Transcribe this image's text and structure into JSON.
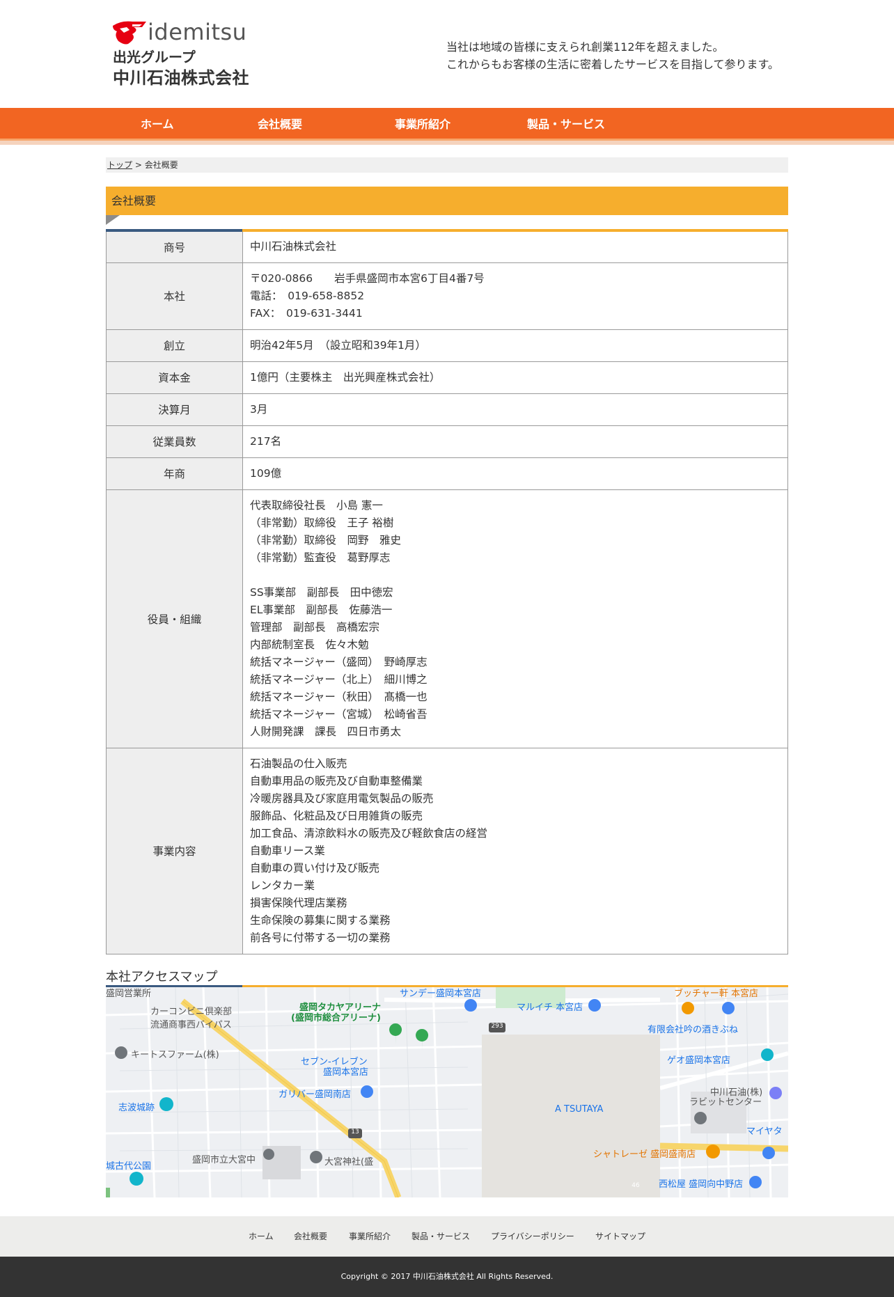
{
  "header": {
    "logo_word": "idemitsu",
    "logo_group": "出光グループ",
    "logo_company": "中川石油株式会社",
    "tagline_line1": "当社は地域の皆様に支えられ創業112年を超えました。",
    "tagline_line2": "これからもお客様の生活に密着したサービスを目指して参ります。"
  },
  "nav": {
    "items": [
      "ホーム",
      "会社概要",
      "事業所紹介",
      "製品・サービス"
    ]
  },
  "breadcrumb": {
    "top": "トップ",
    "separator": " > ",
    "current": "会社概要"
  },
  "section": {
    "title": "会社概要"
  },
  "company": {
    "rows": [
      {
        "label": "商号",
        "lines": [
          "中川石油株式会社"
        ]
      },
      {
        "label": "本社",
        "lines": [
          "〒020-0866　　岩手県盛岡市本宮6丁目4番7号",
          "電話：　019-658-8852",
          "FAX：　019-631-3441"
        ]
      },
      {
        "label": "創立",
        "lines": [
          "明治42年5月　（設立昭和39年1月）"
        ]
      },
      {
        "label": "資本金",
        "lines": [
          "1億円（主要株主　出光興産株式会社）"
        ]
      },
      {
        "label": "決算月",
        "lines": [
          "3月"
        ]
      },
      {
        "label": "従業員数",
        "lines": [
          "217名"
        ]
      },
      {
        "label": "年商",
        "lines": [
          "109億"
        ]
      },
      {
        "label": "役員・組織",
        "lines": [
          "代表取締役社長　小島 憲一",
          "（非常勤）取締役　王子 裕樹",
          "（非常勤）取締役　岡野　雅史",
          "（非常勤）監査役　葛野厚志",
          "",
          "SS事業部　副部長　田中徳宏",
          "EL事業部　副部長　佐藤浩一",
          "管理部　副部長　高橋宏宗",
          "内部統制室長　佐々木勉",
          "統括マネージャー（盛岡）　野崎厚志",
          "統括マネージャー（北上）　細川博之",
          "統括マネージャー（秋田）　髙橋一也",
          "統括マネージャー（宮城）　松崎省吾",
          "人財開発課　課長　四日市勇太"
        ]
      },
      {
        "label": "事業内容",
        "lines": [
          "石油製品の仕入販売",
          "自動車用品の販売及び自動車整備業",
          "冷暖房器具及び家庭用電気製品の販売",
          "服飾品、化粧品及び日用雑貨の販売",
          "加工食品、清涼飲料水の販売及び軽飲食店の経営",
          "自動車リース業",
          "自動車の買い付け及び販売",
          "レンタカー業",
          "損害保険代理店業務",
          "生命保険の募集に関する業務",
          "前各号に付帯する一切の業務"
        ]
      }
    ]
  },
  "map": {
    "title": "本社アクセスマップ",
    "labels": [
      {
        "text": "盛岡営業所",
        "color": "#555"
      },
      {
        "text": "カーコンビニ倶楽部",
        "color": "#555"
      },
      {
        "text": "流通商事西バイパス",
        "color": "#555"
      },
      {
        "text": "盛岡タカヤアリーナ",
        "color": "#1e8e3e"
      },
      {
        "text": "(盛岡市総合アリーナ)",
        "color": "#1e8e3e"
      },
      {
        "text": "サンデー盛岡本宮店",
        "color": "#1a73e8"
      },
      {
        "text": "マルイチ 本宮店",
        "color": "#1a73e8"
      },
      {
        "text": "ブッチャー軒 本宮店",
        "color": "#e37400"
      },
      {
        "text": "有限会社吟の酒きぶね",
        "color": "#1a73e8"
      },
      {
        "text": "キートスファーム(株)",
        "color": "#555"
      },
      {
        "text": "セブン-イレブン",
        "color": "#1a73e8"
      },
      {
        "text": "盛岡本宮店",
        "color": "#1a73e8"
      },
      {
        "text": "ゲオ盛岡本宮店",
        "color": "#1a73e8"
      },
      {
        "text": "ガリバー盛岡南店",
        "color": "#1a73e8"
      },
      {
        "text": "中川石油(株)",
        "color": "#555"
      },
      {
        "text": "ラビットセンター",
        "color": "#555"
      },
      {
        "text": "志波城跡",
        "color": "#1a73e8"
      },
      {
        "text": "A TSUTAYA",
        "color": "#1a73e8"
      },
      {
        "text": "マイヤタ",
        "color": "#1a73e8"
      },
      {
        "text": "シャトレーゼ 盛岡盛南店",
        "color": "#e37400"
      },
      {
        "text": "盛岡市立大宮中",
        "color": "#555"
      },
      {
        "text": "大宮神社(盛",
        "color": "#555"
      },
      {
        "text": "城古代公園",
        "color": "#1a73e8"
      },
      {
        "text": "西松屋 盛岡向中野店",
        "color": "#1a73e8"
      }
    ],
    "road_numbers": [
      "293",
      "13",
      "46"
    ]
  },
  "footer": {
    "links": [
      "ホーム",
      "会社概要",
      "事業所紹介",
      "製品・サービス",
      "プライバシーポリシー",
      "サイトマップ"
    ],
    "copyright": "Copyright © 2017 中川石油株式会社 All Rights Reserved."
  },
  "colors": {
    "nav": "#f26522",
    "section": "#f6ae2d",
    "accent_blue": "#3a5a80",
    "logo_red": "#e60012"
  }
}
